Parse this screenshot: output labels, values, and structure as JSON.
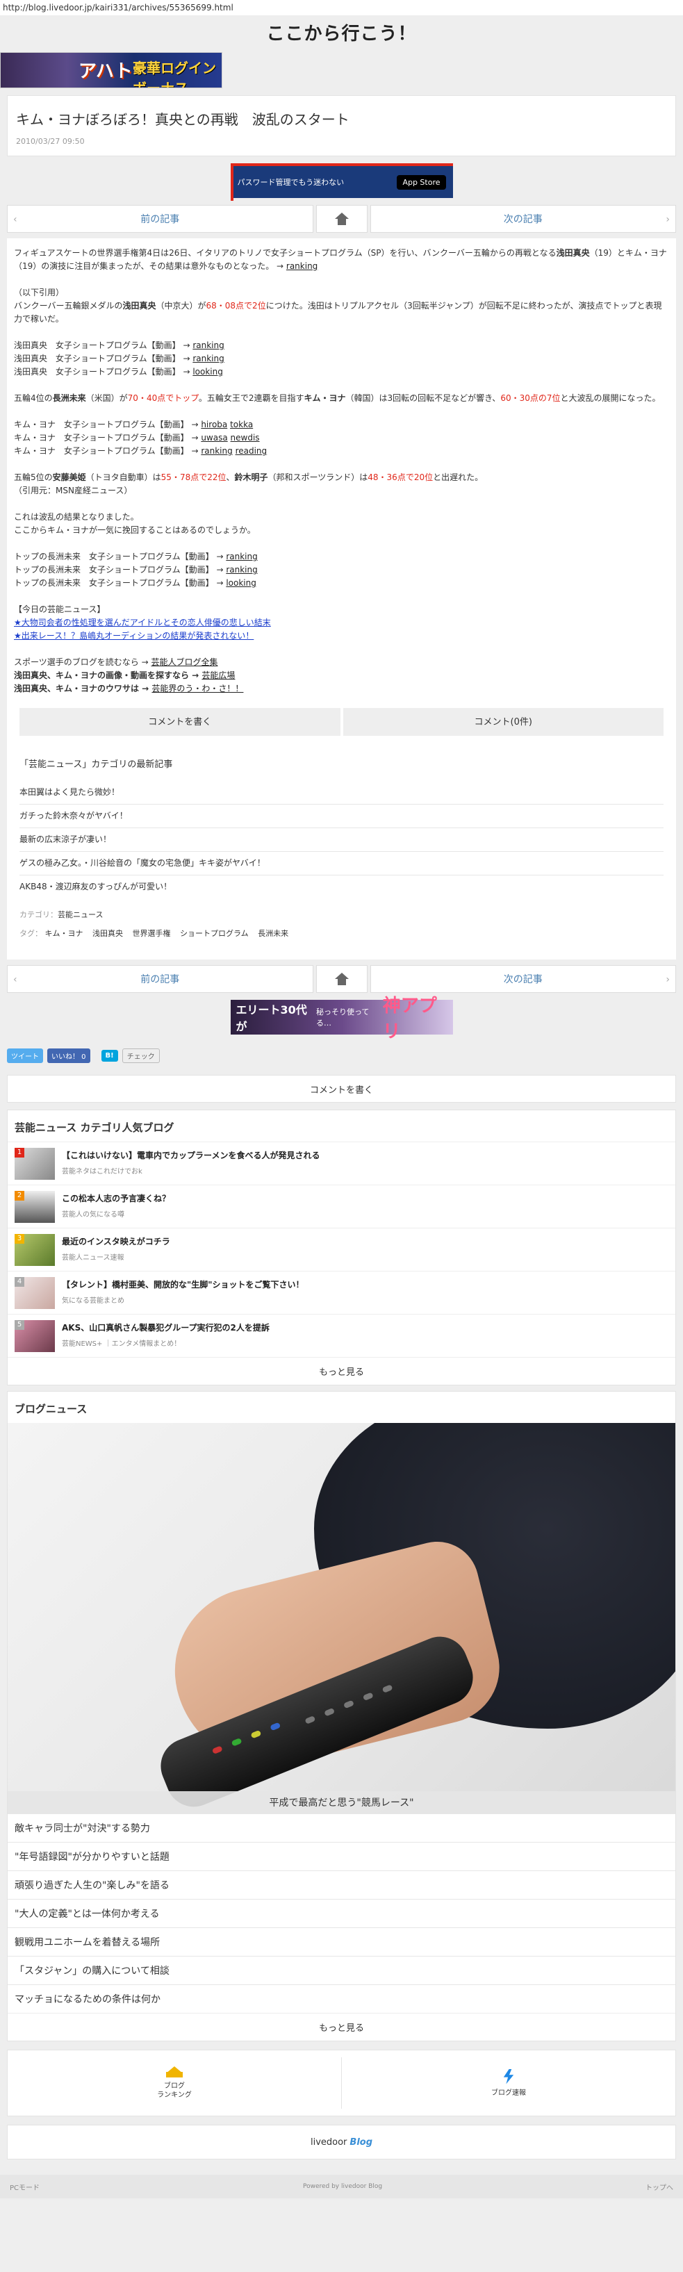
{
  "url": "http://blog.livedoor.jp/kairi331/archives/55365699.html",
  "site_title": "ここから行こう！",
  "top_banner": {
    "t1": "アハト",
    "t2": "豪華ログインボーナス",
    "t3": ""
  },
  "article": {
    "title": "キム・ヨナぼろぼろ！真央との再戦　波乱のスタート",
    "date": "2010/03/27 09:50"
  },
  "pw_banner": {
    "text": "パスワード管理でもう迷わない",
    "store": "App Store"
  },
  "pager": {
    "prev": "前の記事",
    "next": "次の記事"
  },
  "body": {
    "p1a": "フィギュアスケートの世界選手権第4日は26日、イタリアのトリノで女子ショートプログラム（SP）を行い、バンクーバー五輪からの再戦となる",
    "p1b": "浅田真央",
    "p1c": "（19）とキム・ヨナ（19）の演技に注目が集まったが、その結果は意外なものとなった。 → ",
    "p1link": "ranking",
    "quote": "（以下引用）",
    "p2a": "バンクーバー五輪銀メダルの",
    "p2b": "浅田真央",
    "p2c": "（中京大）が",
    "p2red": "68・08点で2位",
    "p2d": "につけた。浅田はトリプルアクセル（3回転半ジャンプ）が回転不足に終わったが、演技点でトップと表現力で稼いだ。",
    "v1": "浅田真央　女子ショートプログラム【動画】 → ",
    "v1l": "ranking",
    "v2": "浅田真央　女子ショートプログラム【動画】 → ",
    "v2l": "ranking",
    "v3": "浅田真央　女子ショートプログラム【動画】 → ",
    "v3l": "looking",
    "p3a": "五輪4位の",
    "p3b": "長洲未来",
    "p3c": "（米国）が",
    "p3red": "70・40点でトップ",
    "p3d": "。五輪女王で2連覇を目指す",
    "p3e": "キム・ヨナ",
    "p3f": "（韓国）は3回転の回転不足などが響き、",
    "p3red2": "60・30点の7位",
    "p3g": "と大波乱の展開になった。",
    "k1": "キム・ヨナ　女子ショートプログラム【動画】 → ",
    "k1l": "hiroba",
    "k1l2": "tokka",
    "k2": "キム・ヨナ　女子ショートプログラム【動画】 → ",
    "k2l": "uwasa",
    "k2l2": "newdis",
    "k3": "キム・ヨナ　女子ショートプログラム【動画】 → ",
    "k3l": "ranking",
    "k3l2": "reading",
    "p4a": "五輪5位の",
    "p4b": "安藤美姫",
    "p4c": "（トヨタ自動車）は",
    "p4red": "55・78点で22位",
    "p4d": "、",
    "p4e": "鈴木明子",
    "p4f": "（邦和スポーツランド）は",
    "p4red2": "48・36点で20位",
    "p4g": "と出遅れた。",
    "cite": "（引用元：MSN産経ニュース）",
    "p5": "これは波乱の結果となりました。",
    "p6": "ここからキム・ヨナが一気に挽回することはあるのでしょうか。",
    "n1": "トップの長洲未来　女子ショートプログラム【動画】 → ",
    "n1l": "ranking",
    "n2": "トップの長洲未来　女子ショートプログラム【動画】 → ",
    "n2l": "ranking",
    "n3": "トップの長洲未来　女子ショートプログラム【動画】 → ",
    "n3l": "looking",
    "today": "【今日の芸能ニュース】",
    "t1": "★大物司会者の性処理を選んだアイドルとその恋人俳優の悲しい結末",
    "t2": "★出来レース！？島嶋丸オーディションの結果が発表されない！",
    "s1": "スポーツ選手のブログを読むなら → ",
    "s1l": "芸能人ブログ全集",
    "s2a": "浅田真央、キム・ヨナの画像・動画を探すなら → ",
    "s2l": "芸能広場",
    "s3a": "浅田真央、キム・ヨナのウワサは → ",
    "s3l": "芸能界のう・わ・さ！！"
  },
  "comment": {
    "write": "コメントを書く",
    "count": "コメント(0件)"
  },
  "category": {
    "head": "「芸能ニュース」カテゴリの最新記事",
    "items": [
      "本田翼はよく見たら微妙！",
      "ガチった鈴木奈々がヤバイ！",
      "最新の広末涼子が凄い！",
      "ゲスの極み乙女。・川谷絵音の「魔女の宅急便」キキ姿がヤバイ！",
      "AKB48・渡辺麻友のすっぴんが可愛い！"
    ],
    "cat_label": "カテゴリ：",
    "cat_value": "芸能ニュース",
    "tag_label": "タグ：",
    "tags": [
      "キム・ヨナ",
      "浅田真央",
      "世界選手権",
      "ショートプログラム",
      "長洲未来"
    ]
  },
  "app_banner": {
    "a": "エリート30代が",
    "b": "秘っそり使ってる…",
    "c": "神アプリ"
  },
  "social": {
    "tweet": "ツイート",
    "like": "いいね！ 0",
    "hatena": "B!",
    "check": "チェック"
  },
  "comment_write2": "コメントを書く",
  "ranking": {
    "head": "芸能ニュース カテゴリ人気ブログ",
    "items": [
      {
        "num": "1",
        "title": "【これはいけない】電車内でカップラーメンを食べる人が発見される",
        "sub": "芸能ネタはこれだけでおk",
        "color": "#e0271a"
      },
      {
        "num": "2",
        "title": "この松本人志の予言凄くね？",
        "sub": "芸能人の気になる噂",
        "color": "#f28b00"
      },
      {
        "num": "3",
        "title": "最近のインスタ映えがコチラ",
        "sub": "芸能人ニュース速報",
        "color": "#f2b400"
      },
      {
        "num": "4",
        "title": "【タレント】橋村亜美、開放的な\"生脚\"ショットをご覧下さい！",
        "sub": "気になる芸能まとめ",
        "color": "#aaaaaa"
      },
      {
        "num": "5",
        "title": "AKS、山口真帆さん製暴犯グループ実行犯の2人を提訴",
        "sub": "芸能NEWS+ ｜エンタメ情報まとめ！",
        "color": "#aaaaaa"
      }
    ],
    "more": "もっと見る"
  },
  "news": {
    "head": "ブログニュース",
    "caption": "平成で最高だと思う\"競馬レース\"",
    "items": [
      "敵キャラ同士が\"対決\"する勢力",
      "\"年号語録図\"が分かりやすいと話題",
      "頑張り過ぎた人生の\"楽しみ\"を語る",
      "\"大人の定義\"とは一体何か考える",
      "観戦用ユニホームを着替える場所",
      "「スタジャン」の購入について相談",
      "マッチョになるための条件は何か"
    ],
    "more": "もっと見る"
  },
  "footer": {
    "rank_a": "ブログ",
    "rank_b": "ランキング",
    "quick": "ブログ速報",
    "logo_a": "livedoor",
    "logo_b": "Blog",
    "pc": "PCモード",
    "powered": "Powered by livedoor Blog",
    "top": "トップへ"
  }
}
